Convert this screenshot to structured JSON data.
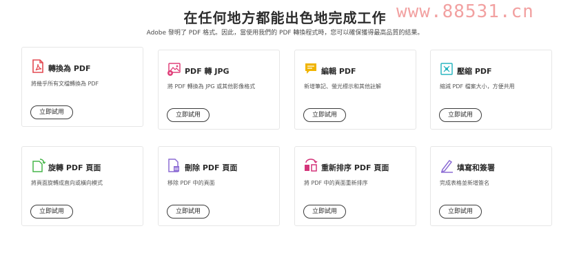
{
  "header": {
    "title": "在任何地方都能出色地完成工作",
    "subtitle": "Adobe 發明了 PDF 格式。因此，當使用我們的 PDF 轉換程式時，您可以確保獲得最高品質的結果。",
    "watermark": "www.88531.cn"
  },
  "tools": [
    {
      "title": "轉換為 PDF",
      "desc": "將幾乎所有文檔轉換為 PDF",
      "button": "立即試用",
      "icon": "acrobat-pdf-icon",
      "color": "#e34850"
    },
    {
      "title": "PDF 轉 JPG",
      "desc": "將 PDF 轉換為 JPG 或其他影像格式",
      "button": "立即試用",
      "icon": "image-convert-icon",
      "color": "#e0407a"
    },
    {
      "title": "編輯 PDF",
      "desc": "新增筆記、螢光標示和其他註解",
      "button": "立即試用",
      "icon": "comment-edit-icon",
      "color": "#f0b400"
    },
    {
      "title": "壓縮 PDF",
      "desc": "縮減 PDF 檔案大小，方便共用",
      "button": "立即試用",
      "icon": "compress-icon",
      "color": "#2ab5c0"
    },
    {
      "title": "旋轉 PDF 頁面",
      "desc": "將頁面旋轉成直向或橫向模式",
      "button": "立即試用",
      "icon": "rotate-page-icon",
      "color": "#47b54a"
    },
    {
      "title": "刪除 PDF 頁面",
      "desc": "移除 PDF 中的頁面",
      "button": "立即試用",
      "icon": "delete-page-icon",
      "color": "#8b6bd4"
    },
    {
      "title": "重新排序 PDF 頁面",
      "desc": "將 PDF 中的頁面重新排序",
      "button": "立即試用",
      "icon": "reorder-pages-icon",
      "color": "#d4347a"
    },
    {
      "title": "填寫和簽署",
      "desc": "完成表格並新增簽名",
      "button": "立即試用",
      "icon": "sign-pen-icon",
      "color": "#8b6bd4"
    }
  ]
}
